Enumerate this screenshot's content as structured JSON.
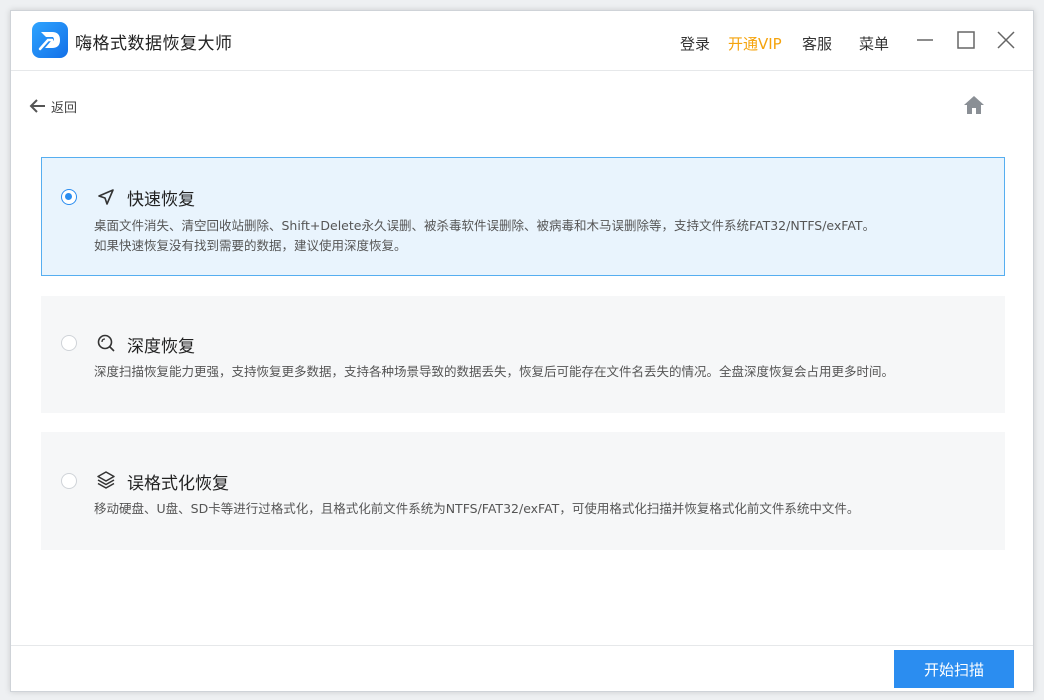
{
  "app": {
    "title": "嗨格式数据恢复大师"
  },
  "header": {
    "login": "登录",
    "vip": "开通VIP",
    "service": "客服",
    "menu": "菜单"
  },
  "nav": {
    "back_label": "返回"
  },
  "options": [
    {
      "title": "快速恢复",
      "desc_lines": [
        "桌面文件消失、清空回收站删除、Shift+Delete永久误删、被杀毒软件误删除、被病毒和木马误删除等，支持文件系统FAT32/NTFS/exFAT。",
        "如果快速恢复没有找到需要的数据，建议使用深度恢复。"
      ],
      "selected": true,
      "icon": "navigation-arrow-icon"
    },
    {
      "title": "深度恢复",
      "desc_lines": [
        "深度扫描恢复能力更强，支持恢复更多数据，支持各种场景导致的数据丢失，恢复后可能存在文件名丢失的情况。全盘深度恢复会占用更多时间。"
      ],
      "selected": false,
      "icon": "deep-search-icon"
    },
    {
      "title": "误格式化恢复",
      "desc_lines": [
        "移动硬盘、U盘、SD卡等进行过格式化，且格式化前文件系统为NTFS/FAT32/exFAT，可使用格式化扫描并恢复格式化前文件系统中文件。"
      ],
      "selected": false,
      "icon": "layers-icon"
    }
  ],
  "footer": {
    "start_label": "开始扫描"
  },
  "colors": {
    "accent": "#2b8df0",
    "vip": "#f5a30c",
    "selected_bg": "#e9f4fd",
    "selected_border": "#56aef0",
    "card_bg": "#f6f7f8"
  }
}
